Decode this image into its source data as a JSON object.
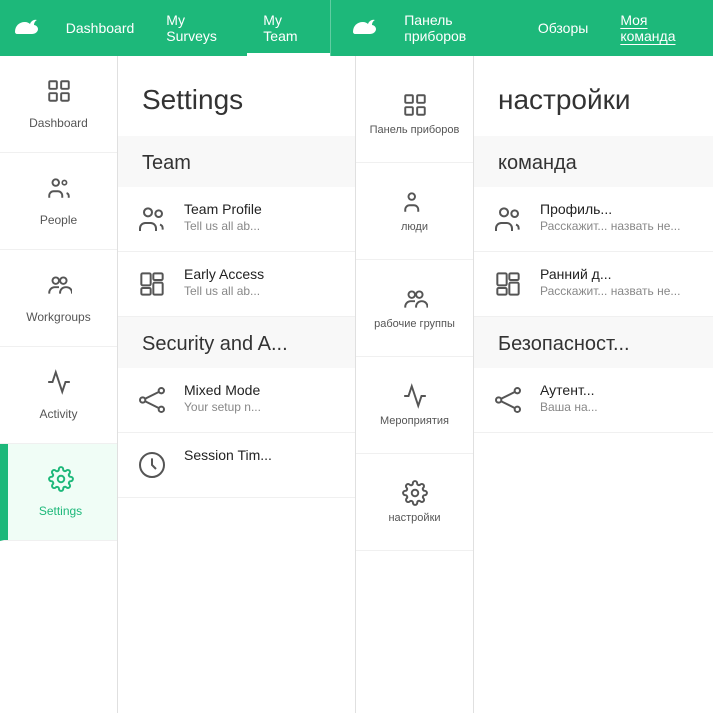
{
  "nav": {
    "logo": "☁",
    "items": [
      {
        "label": "Dashboard",
        "active": false
      },
      {
        "label": "My Surveys",
        "active": false
      },
      {
        "label": "My Team",
        "active": true
      }
    ],
    "items2": [
      {
        "label": "Панель приборов",
        "active": false
      },
      {
        "label": "Обзоры",
        "active": false
      },
      {
        "label": "Моя команда",
        "active": false
      }
    ]
  },
  "sidebar": {
    "items": [
      {
        "label": "Dashboard",
        "icon": "dashboard"
      },
      {
        "label": "People",
        "icon": "people"
      },
      {
        "label": "Workgroups",
        "icon": "workgroups"
      },
      {
        "label": "Activity",
        "icon": "activity"
      },
      {
        "label": "Settings",
        "icon": "settings",
        "active": true
      }
    ]
  },
  "middle_nav": {
    "items": [
      {
        "label": "Панель приборов",
        "icon": "dashboard"
      },
      {
        "label": "люди",
        "icon": "people"
      },
      {
        "label": "рабочие группы",
        "icon": "workgroups"
      },
      {
        "label": "Мероприятия",
        "icon": "activity"
      },
      {
        "label": "настройки",
        "icon": "settings"
      }
    ]
  },
  "settings": {
    "title": "Settings",
    "sections": [
      {
        "title": "Team",
        "items": [
          {
            "name": "Team Profile",
            "desc": "Tell us all ab...",
            "icon": "team"
          },
          {
            "name": "Early Access",
            "desc": "Tell us all ab...",
            "icon": "early"
          }
        ]
      },
      {
        "title": "Security and A...",
        "items": [
          {
            "name": "Mixed Mode",
            "desc": "Your setup n...",
            "icon": "mixed"
          },
          {
            "name": "Session Tim...",
            "desc": "",
            "icon": "session"
          }
        ]
      }
    ]
  },
  "russian": {
    "title": "настройки",
    "sections": [
      {
        "title": "команда",
        "items": [
          {
            "name": "Профиль...",
            "desc": "Расскажит... назвать не...",
            "icon": "team"
          },
          {
            "name": "Ранний д...",
            "desc": "Расскажит... назвать не...",
            "icon": "early"
          }
        ]
      },
      {
        "title": "Безопасност...",
        "items": [
          {
            "name": "Аутент...",
            "desc": "Ваша на...",
            "icon": "mixed"
          }
        ]
      }
    ]
  }
}
